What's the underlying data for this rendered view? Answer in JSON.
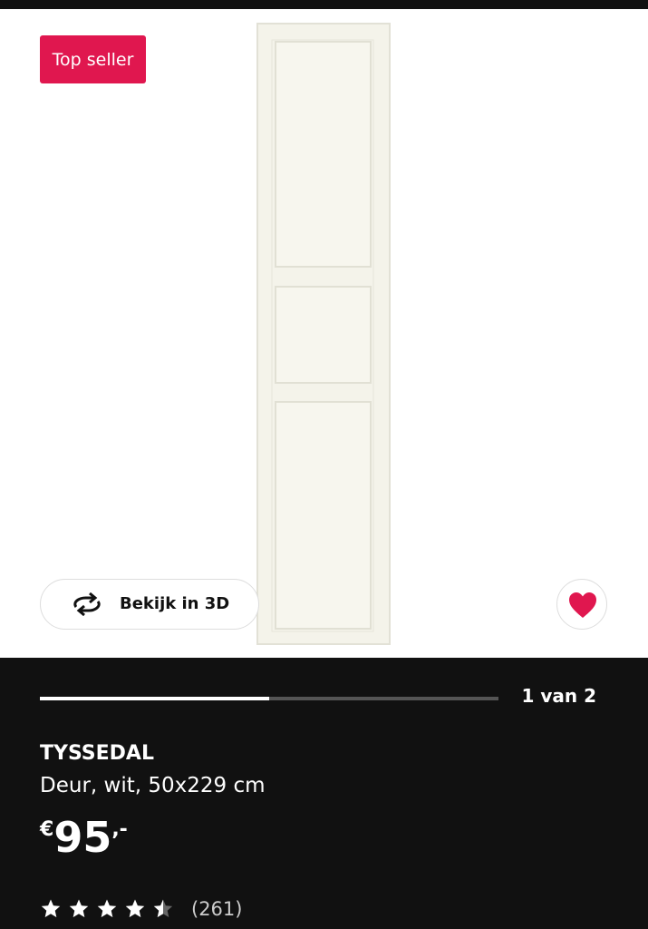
{
  "badge": {
    "label": "Top seller"
  },
  "view3d": {
    "label": "Bekijk in 3D",
    "icon": "rotate-3d-icon"
  },
  "favorite": {
    "icon": "heart-icon",
    "color": "#e0174f"
  },
  "gallery": {
    "current": 1,
    "total": 2,
    "counter_text": "1 van 2",
    "progress": 0.5
  },
  "product": {
    "name": "TYSSEDAL",
    "description": "Deur, wit, 50x229 cm",
    "price": {
      "currency": "€",
      "amount": "95",
      "decimals": ",-"
    },
    "rating": {
      "value": 4.5,
      "max": 5,
      "count_text": "(261)"
    }
  },
  "colors": {
    "accent": "#e0174f",
    "background": "#111111",
    "image_bg": "#ffffff",
    "door": "#f4f3ea"
  }
}
